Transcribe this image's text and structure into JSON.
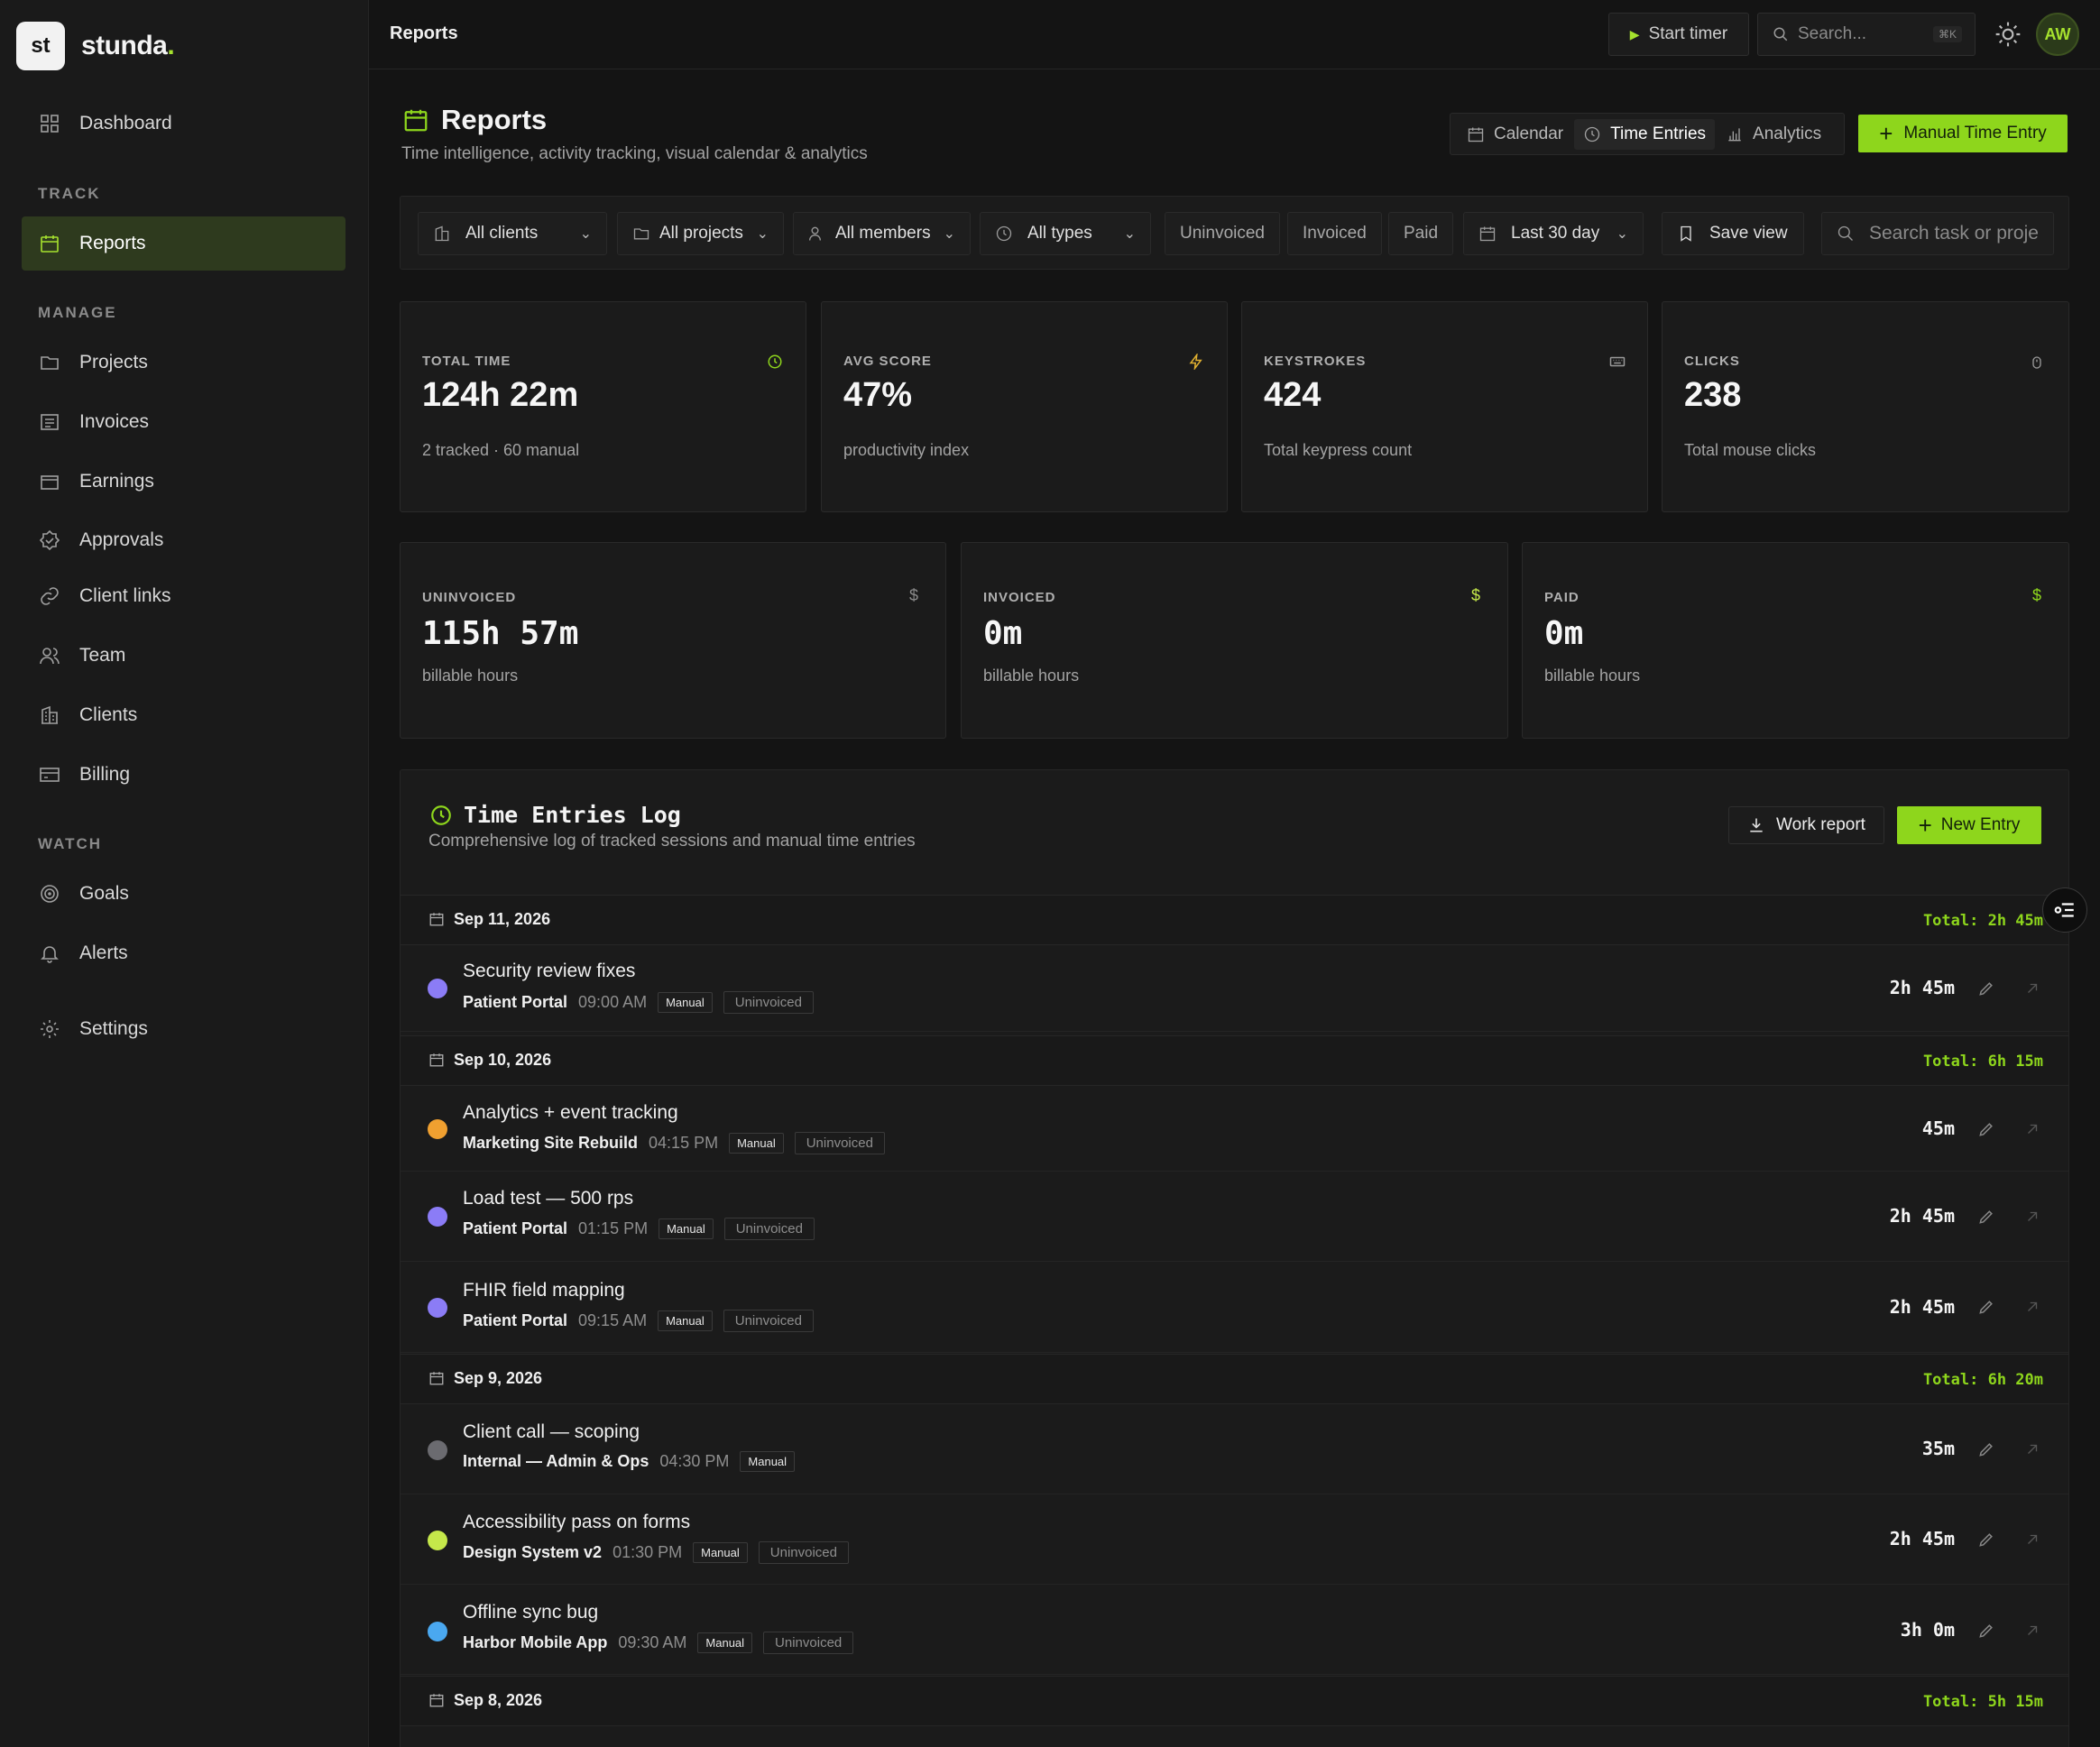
{
  "brand": {
    "logo_mark": "st",
    "name": "stunda"
  },
  "sidebar": {
    "dashboard": "Dashboard",
    "sections": {
      "track": "TRACK",
      "manage": "MANAGE",
      "watch": "WATCH"
    },
    "items": {
      "reports": "Reports",
      "projects": "Projects",
      "invoices": "Invoices",
      "earnings": "Earnings",
      "approvals": "Approvals",
      "client_links": "Client links",
      "team": "Team",
      "clients": "Clients",
      "billing": "Billing",
      "goals": "Goals",
      "alerts": "Alerts",
      "settings": "Settings"
    }
  },
  "topbar": {
    "title": "Reports",
    "start_timer": "Start timer",
    "search_placeholder": "Search...",
    "shortcut": "⌘K",
    "avatar": "AW"
  },
  "page": {
    "title": "Reports",
    "subtitle": "Time intelligence, activity tracking, visual calendar & analytics",
    "views": {
      "calendar": "Calendar",
      "time_entries": "Time Entries",
      "analytics": "Analytics"
    },
    "manual_entry": "Manual Time Entry"
  },
  "filters": {
    "clients": "All clients",
    "projects": "All projects",
    "members": "All members",
    "types": "All types",
    "uninvoiced": "Uninvoiced",
    "invoiced": "Invoiced",
    "paid": "Paid",
    "range": "Last 30 day",
    "save_view": "Save view",
    "search_placeholder": "Search task or proje"
  },
  "stats": {
    "total_time": {
      "label": "TOTAL TIME",
      "value": "124h 22m",
      "sub": "2 tracked · 60 manual"
    },
    "avg_score": {
      "label": "AVG SCORE",
      "value": "47%",
      "sub": "productivity index"
    },
    "keystrokes": {
      "label": "KEYSTROKES",
      "value": "424",
      "sub": "Total keypress count"
    },
    "clicks": {
      "label": "CLICKS",
      "value": "238",
      "sub": "Total mouse clicks"
    },
    "uninvoiced": {
      "label": "UNINVOICED",
      "value": "115h 57m",
      "sub": "billable hours"
    },
    "invoiced": {
      "label": "INVOICED",
      "value": "0m",
      "sub": "billable hours"
    },
    "paid": {
      "label": "PAID",
      "value": "0m",
      "sub": "billable hours"
    },
    "currency_symbol": "$"
  },
  "log": {
    "title": "Time Entries Log",
    "subtitle": "Comprehensive log of tracked sessions and manual time entries",
    "work_report": "Work report",
    "new_entry": "New Entry",
    "days": [
      {
        "date": "Sep 11, 2026",
        "total": "Total: 2h 45m"
      },
      {
        "date": "Sep 10, 2026",
        "total": "Total: 6h 15m"
      },
      {
        "date": "Sep 9, 2026",
        "total": "Total: 6h 20m"
      },
      {
        "date": "Sep 8, 2026",
        "total": "Total: 5h 15m"
      }
    ],
    "entries": [
      {
        "title": "Security review fixes",
        "project": "Patient Portal",
        "time": "09:00 AM",
        "type": "Manual",
        "status": "Uninvoiced",
        "duration": "2h 45m",
        "color": "#8b7cf6"
      },
      {
        "title": "Analytics + event tracking",
        "project": "Marketing Site Rebuild",
        "time": "04:15 PM",
        "type": "Manual",
        "status": "Uninvoiced",
        "duration": "45m",
        "color": "#f0a030"
      },
      {
        "title": "Load test — 500 rps",
        "project": "Patient Portal",
        "time": "01:15 PM",
        "type": "Manual",
        "status": "Uninvoiced",
        "duration": "2h 45m",
        "color": "#8b7cf6"
      },
      {
        "title": "FHIR field mapping",
        "project": "Patient Portal",
        "time": "09:15 AM",
        "type": "Manual",
        "status": "Uninvoiced",
        "duration": "2h 45m",
        "color": "#8b7cf6"
      },
      {
        "title": "Client call — scoping",
        "project": "Internal — Admin & Ops",
        "time": "04:30 PM",
        "type": "Manual",
        "status": "",
        "duration": "35m",
        "color": "#6b6b70"
      },
      {
        "title": "Accessibility pass on forms",
        "project": "Design System v2",
        "time": "01:30 PM",
        "type": "Manual",
        "status": "Uninvoiced",
        "duration": "2h 45m",
        "color": "#c5e84a"
      },
      {
        "title": "Offline sync bug",
        "project": "Harbor Mobile App",
        "time": "09:30 AM",
        "type": "Manual",
        "status": "Uninvoiced",
        "duration": "3h 0m",
        "color": "#4aa8f0"
      }
    ]
  },
  "colors": {
    "accent": "#8ed61c",
    "background": "#141414",
    "surface": "#1b1b1b"
  }
}
